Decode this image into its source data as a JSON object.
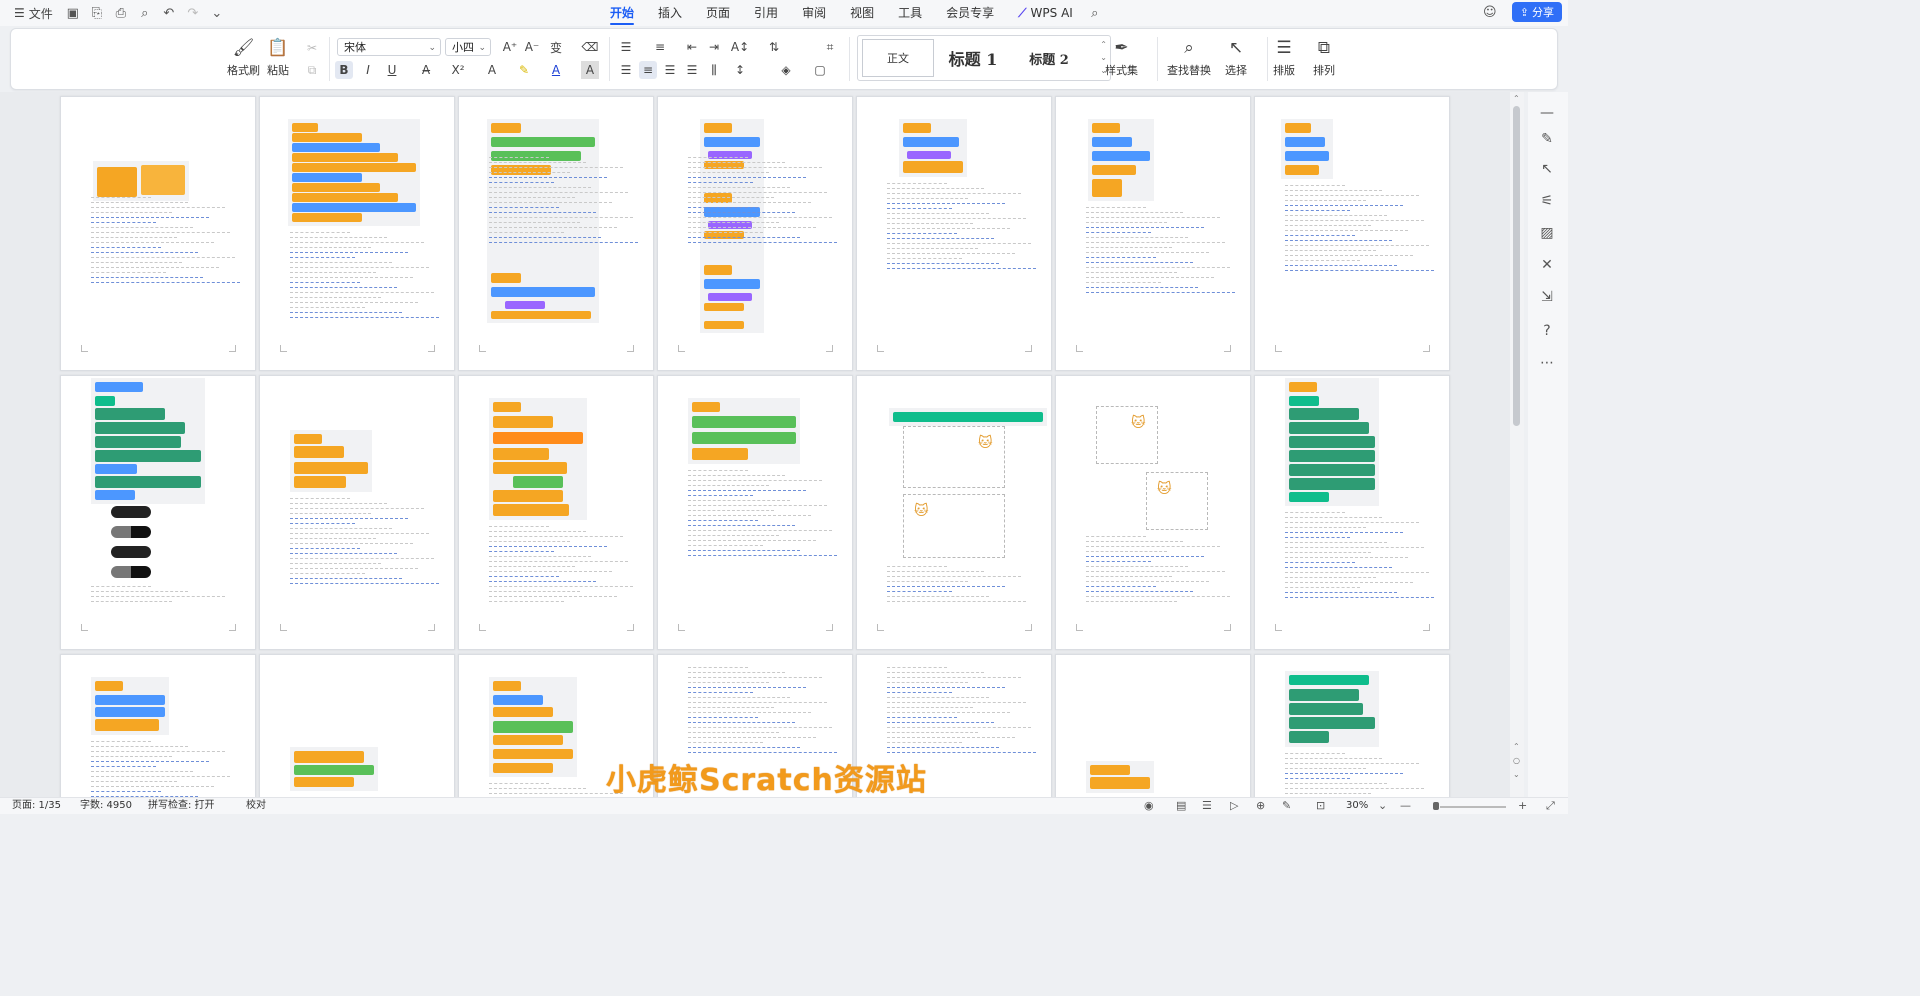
{
  "menubar": {
    "menu_icon": "hamburger-icon",
    "file_label": "文件",
    "tabs": [
      "开始",
      "插入",
      "页面",
      "引用",
      "审阅",
      "视图",
      "工具",
      "会员专享"
    ],
    "active_tab": "开始",
    "wps_ai_label": "WPS AI",
    "share_label": "分享",
    "accent_color": "#1b5df5"
  },
  "ribbon": {
    "format_painter": "格式刷",
    "paste": "粘贴",
    "font_name": "宋体",
    "font_size": "小四",
    "styles": {
      "normal": "正文",
      "heading1": "标题 1",
      "heading2": "标题 2"
    },
    "style_set": "样式集",
    "find_replace": "查找替换",
    "select": "选择",
    "layout": "排版",
    "arrange": "排列"
  },
  "watermark": "小虎鲸Scratch资源站",
  "statusbar": {
    "page": "页面: 1/35",
    "word_count": "字数: 4950",
    "spell_check": "拼写检查: 打开",
    "proofread": "校对",
    "zoom": "30%",
    "zoom_level": 0.3
  }
}
